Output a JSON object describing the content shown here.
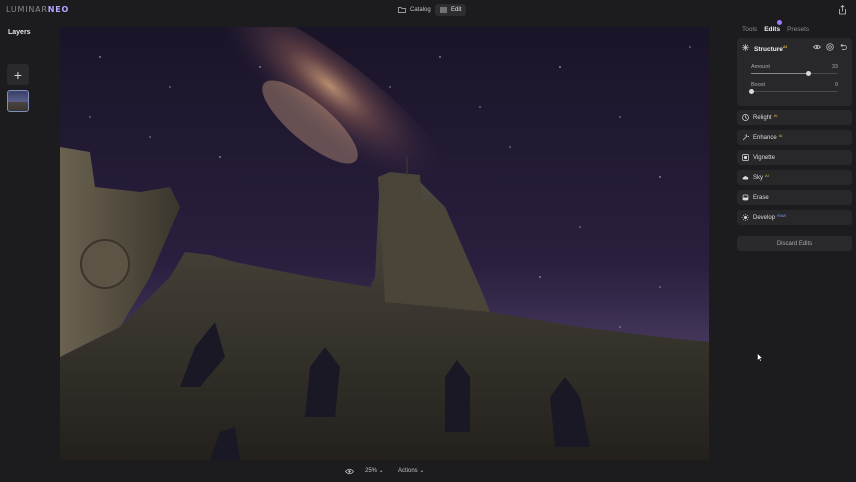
{
  "app": {
    "logo_main": "LUMINAR",
    "logo_accent": "NEO"
  },
  "topbar": {
    "catalog_label": "Catalog",
    "edit_label": "Edit"
  },
  "left_panel": {
    "title": "Layers"
  },
  "bottom_bar": {
    "zoom": "25% ⌄",
    "actions": "Actions ⌄"
  },
  "right_panel": {
    "tabs": [
      "Tools",
      "Edits",
      "Presets"
    ],
    "active_tab": "Edits",
    "structure": {
      "title": "Structure",
      "ai_badge": "AI",
      "sliders": [
        {
          "label": "Amount",
          "value": "33",
          "fraction": 0.66
        },
        {
          "label": "Boost",
          "value": "0",
          "fraction": 0.0
        }
      ]
    },
    "tools": [
      {
        "label": "Relight",
        "badge": "AI",
        "icon": "relight-icon"
      },
      {
        "label": "Enhance",
        "badge": "AI",
        "icon": "enhance-icon"
      },
      {
        "label": "Vignette",
        "badge": "",
        "icon": "vignette-icon"
      },
      {
        "label": "Sky",
        "badge": "AI",
        "icon": "sky-icon"
      },
      {
        "label": "Erase",
        "badge": "",
        "icon": "erase-icon"
      },
      {
        "label": "Develop",
        "badge": "RAW",
        "icon": "develop-icon"
      }
    ],
    "discard_label": "Discard Edits"
  },
  "colors": {
    "accent": "#9d7bff",
    "ai_badge": "#e0b34a",
    "panel": "#28282b",
    "background": "#1c1c1e"
  }
}
